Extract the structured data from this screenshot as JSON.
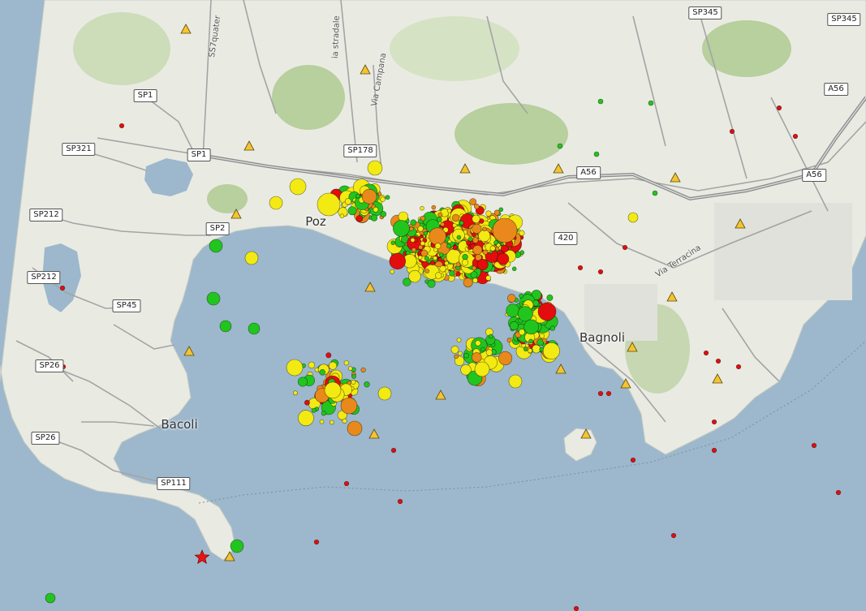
{
  "map": {
    "colors": {
      "sea": "#9db8cc",
      "land": "#e9ebe3",
      "vegetation": "#b8cf9e",
      "road": "#9b9b9b",
      "highway": "#8a8a8a",
      "quake_green": "#22c41e",
      "quake_yellow": "#f2ea12",
      "quake_orange": "#e9891c",
      "quake_red": "#e30d0d",
      "station": "#f4c430",
      "epicenter_star": "#e81414"
    },
    "road_labels": [
      {
        "text": "SP1"
      },
      {
        "text": "SP321"
      },
      {
        "text": "SP1"
      },
      {
        "text": "SP212"
      },
      {
        "text": "SP2"
      },
      {
        "text": "SP212"
      },
      {
        "text": "SP45"
      },
      {
        "text": "SP26"
      },
      {
        "text": "SP26"
      },
      {
        "text": "SP111"
      },
      {
        "text": "SP178"
      },
      {
        "text": "A56"
      },
      {
        "text": "A56"
      },
      {
        "text": "A56"
      },
      {
        "text": "SP345"
      },
      {
        "text": "SP345"
      },
      {
        "text": "420"
      }
    ],
    "place_labels": [
      {
        "text": "Bacoli"
      },
      {
        "text": "Bagnoli"
      },
      {
        "text": "Poz"
      }
    ],
    "street_labels": [
      {
        "text": "SS7quater"
      },
      {
        "text": "ia stradale"
      },
      {
        "text": "Via Campana"
      },
      {
        "text": "Via Terracina"
      }
    ]
  }
}
